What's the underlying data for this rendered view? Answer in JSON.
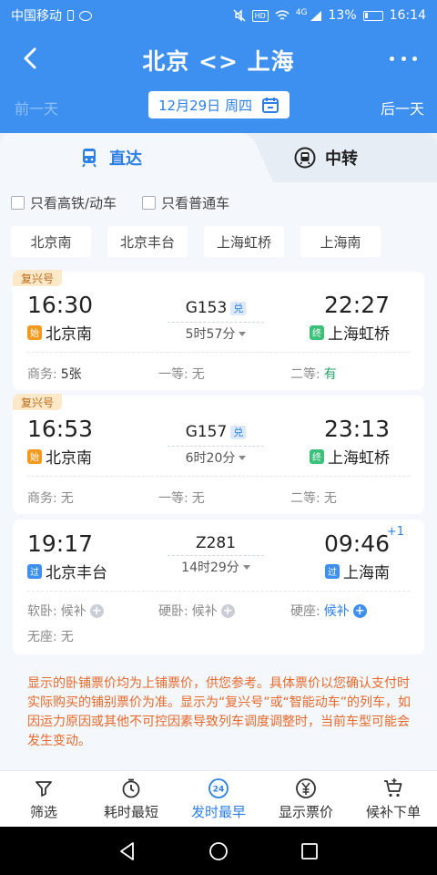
{
  "status_bar": {
    "carrier": "中国移动",
    "battery": "13%",
    "time": "16:14",
    "network": "4G",
    "hd": "HD"
  },
  "header": {
    "title": "北京 <> 上海"
  },
  "date_row": {
    "prev": "前一天",
    "date": "12月29日",
    "weekday": "周四",
    "next": "后一天"
  },
  "tabs": [
    {
      "label": "直达",
      "active": true
    },
    {
      "label": "中转",
      "active": false
    }
  ],
  "filters": [
    {
      "label": "只看高铁/动车"
    },
    {
      "label": "只看普通车"
    }
  ],
  "stations": [
    "北京南",
    "北京丰台",
    "上海虹桥",
    "上海南"
  ],
  "trains": [
    {
      "badge": "复兴号",
      "dep_time": "16:30",
      "arr_time": "22:27",
      "train_no": "G153",
      "dui": "兑",
      "duration": "5时57分",
      "from_tag": "始",
      "from": "北京南",
      "to_tag": "终",
      "to": "上海虹桥",
      "seats": [
        {
          "name": "商务:",
          "value": "5张"
        },
        {
          "name": "一等:",
          "value": "无"
        },
        {
          "name": "二等:",
          "value": "有"
        }
      ]
    },
    {
      "badge": "复兴号",
      "dep_time": "16:53",
      "arr_time": "23:13",
      "train_no": "G157",
      "dui": "兑",
      "duration": "6时20分",
      "from_tag": "始",
      "from": "北京南",
      "to_tag": "终",
      "to": "上海虹桥",
      "seats": [
        {
          "name": "商务:",
          "value": "无"
        },
        {
          "name": "一等:",
          "value": "无"
        },
        {
          "name": "二等:",
          "value": "无"
        }
      ]
    },
    {
      "dep_time": "19:17",
      "arr_time": "09:46",
      "plus_day": "+1",
      "train_no": "Z281",
      "duration": "14时29分",
      "from_tag": "过",
      "from": "北京丰台",
      "to_tag": "过",
      "to": "上海南",
      "seats": [
        {
          "name": "软卧:",
          "value": "候补"
        },
        {
          "name": "硬卧:",
          "value": "候补"
        },
        {
          "name": "硬座:",
          "value": "候补"
        },
        {
          "name": "无座:",
          "value": "无"
        }
      ]
    }
  ],
  "notice": "显示的卧铺票价均为上铺票价，供您参考。具体票价以您确认支付时实际购买的铺别票价为准。显示为“复兴号”或“智能动车”的列车，如因运力原因或其他不可控因素导致列车调度调整时，当前车型可能会发生变动。",
  "toolbar": [
    {
      "label": "筛选",
      "icon": "filter-icon"
    },
    {
      "label": "耗时最短",
      "icon": "timer-icon"
    },
    {
      "label": "发时最早",
      "icon": "clock-24-icon",
      "active": true,
      "icon_text": "24"
    },
    {
      "label": "显示票价",
      "icon": "yuan-icon"
    },
    {
      "label": "候补下单",
      "icon": "cart-plus-icon"
    }
  ],
  "colors": {
    "primary": "#3d8ff0",
    "accent_blue": "#2b7fe6",
    "available_green": "#29a36a",
    "notice_orange": "#e8692b"
  }
}
